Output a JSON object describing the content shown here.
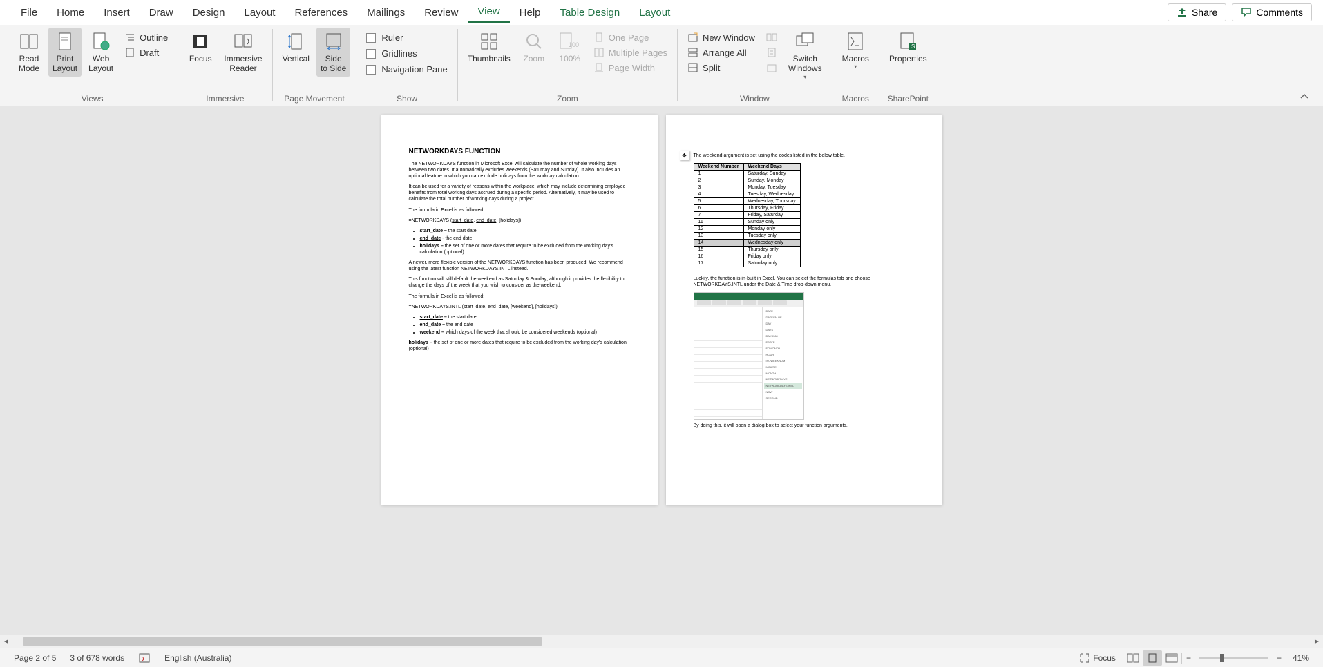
{
  "menubar": {
    "items": [
      "File",
      "Home",
      "Insert",
      "Draw",
      "Design",
      "Layout",
      "References",
      "Mailings",
      "Review",
      "View",
      "Help",
      "Table Design",
      "Layout"
    ],
    "active_index": 9,
    "share": "Share",
    "comments": "Comments"
  },
  "ribbon": {
    "views": {
      "label": "Views",
      "read_mode": "Read\nMode",
      "print_layout": "Print\nLayout",
      "web_layout": "Web\nLayout",
      "outline": "Outline",
      "draft": "Draft"
    },
    "immersive": {
      "label": "Immersive",
      "focus": "Focus",
      "immersive_reader": "Immersive\nReader"
    },
    "page_movement": {
      "label": "Page Movement",
      "vertical": "Vertical",
      "side_to_side": "Side\nto Side"
    },
    "show": {
      "label": "Show",
      "ruler": "Ruler",
      "gridlines": "Gridlines",
      "nav_pane": "Navigation Pane"
    },
    "zoom": {
      "label": "Zoom",
      "thumbnails": "Thumbnails",
      "zoom": "Zoom",
      "hundred": "100%",
      "one_page": "One Page",
      "multiple_pages": "Multiple Pages",
      "page_width": "Page Width"
    },
    "window": {
      "label": "Window",
      "new_window": "New Window",
      "arrange_all": "Arrange All",
      "split": "Split",
      "switch_windows": "Switch\nWindows"
    },
    "macros": {
      "label": "Macros",
      "button": "Macros"
    },
    "sharepoint": {
      "label": "SharePoint",
      "properties": "Properties"
    }
  },
  "doc": {
    "page1": {
      "title": "NETWORKDAYS FUNCTION",
      "p1": "The NETWORKDAYS function in Microsoft Excel will calculate the number of whole working days between two dates. It automatically excludes weekends (Saturday and Sunday). It also includes an optional feature in which you can exclude holidays from the workday calculation.",
      "p2": "It can be used for a variety of reasons within the workplace, which may include determining employee benefits from total working days accrued during a specific period. Alternatively, it may be used to calculate the total number of working days during a project.",
      "p3": "The formula in Excel is as followed:",
      "formula1_prefix": "=NETWORKDAYS (",
      "arg_start": "start_date",
      "arg_end": "end_date",
      "formula1_suffix": ", [holidays])",
      "b1_key": "start_date – ",
      "b1_val": "the start date",
      "b2_key": "end_date",
      "b2_val": " - the end date",
      "b3_key": "holidays – ",
      "b3_val": "the set of one or more dates that require to be excluded from the working day's calculation (optional)",
      "p4": "A newer, more flexible version of the NETWORKDAYS function has been produced. We recommend using the latest function NETWORKDAYS.INTL instead.",
      "p5": "This function will still default the weekend as Saturday & Sunday; although it provides the flexibility to change the days of the week that you wish to consider as the weekend.",
      "p6": "The formula in Excel is as followed:",
      "formula2_prefix": "=NETWORKDAYS.INTL (",
      "formula2_suffix": ", [weekend], [holidays])",
      "b4_key": "start_date – ",
      "b4_val": "the start date",
      "b5_key": "end_date – ",
      "b5_val": "the end date",
      "b6_key": "weekend – ",
      "b6_val": "which days of the week that should be considered weekends (optional)",
      "p7_key": "holidays – ",
      "p7_val": "the set of one or more dates that require to be excluded from the working day's calculation (optional)"
    },
    "page2": {
      "intro": "The weekend argument is set using the codes listed in the below table.",
      "th1": "Weekend Number",
      "th2": "Weekend Days",
      "rows": [
        [
          "1",
          "Saturday, Sunday"
        ],
        [
          "2",
          "Sunday, Monday"
        ],
        [
          "3",
          "Monday, Tuesday"
        ],
        [
          "4",
          "Tuesday, Wednesday"
        ],
        [
          "5",
          "Wednesday, Thursday"
        ],
        [
          "6",
          "Thursday, Friday"
        ],
        [
          "7",
          "Friday, Saturday"
        ],
        [
          "11",
          "Sunday only"
        ],
        [
          "12",
          "Monday only"
        ],
        [
          "13",
          "Tuesday only"
        ],
        [
          "14",
          "Wednesday only"
        ],
        [
          "15",
          "Thursday only"
        ],
        [
          "16",
          "Friday only"
        ],
        [
          "17",
          "Saturday only"
        ]
      ],
      "highlight_index": 10,
      "p2": "Luckily, the function is in-built in Excel. You can select the formulas tab and choose NETWORKDAYS.INTL under the Date & Time drop-down menu.",
      "p3": "By doing this, it will open a dialog box to select your function arguments."
    }
  },
  "status": {
    "page": "Page 2 of 5",
    "words": "3 of 678 words",
    "lang": "English (Australia)",
    "focus": "Focus",
    "zoom": "41%"
  }
}
